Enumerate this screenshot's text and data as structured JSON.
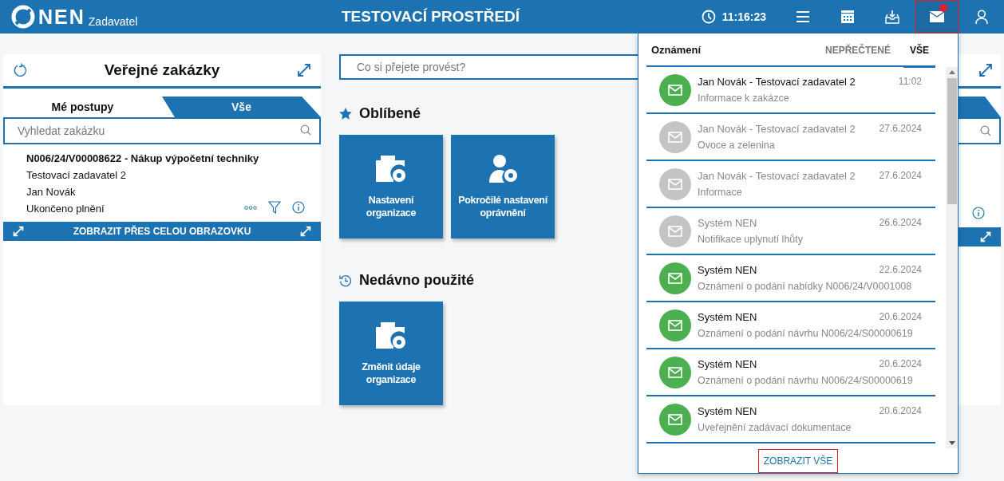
{
  "header": {
    "logo": "NEN",
    "role": "Zadavatel",
    "title": "TESTOVACÍ PROSTŘEDÍ",
    "time": "11:16:23",
    "nav": [
      {
        "kind": "menu",
        "selected": false,
        "badge": false
      },
      {
        "kind": "calendar",
        "selected": false,
        "badge": false
      },
      {
        "kind": "inbox",
        "selected": false,
        "badge": false
      },
      {
        "kind": "mail",
        "selected": true,
        "badge": true
      },
      {
        "kind": "user",
        "selected": false,
        "badge": false
      }
    ]
  },
  "contracts_panel": {
    "title": "Veřejné zakázky",
    "tabs": [
      {
        "label": "Mé postupy",
        "selected": true
      },
      {
        "label": "Vše",
        "selected": false
      }
    ],
    "search": {
      "placeholder": "Vyhledat zakázku"
    },
    "item": {
      "title": "N006/24/V00008622 - Nákup výpočetní techniky",
      "lines": [
        "Testovací zadavatel 2",
        "Jan Novák",
        "Ukončeno plnění"
      ]
    },
    "footer": "ZOBRAZIT PŘES CELOU OBRAZOVKU"
  },
  "command_search": {
    "placeholder": "Co si přejete provést?"
  },
  "favorites": {
    "title": "Oblíbené",
    "tiles": [
      {
        "label": "Nastavení organizace",
        "kind": "org"
      },
      {
        "label": "Pokročilé nastavení oprávnění",
        "kind": "user"
      }
    ]
  },
  "recent": {
    "title": "Nedávno použité",
    "tiles": [
      {
        "label": "Změnit údaje organizace",
        "kind": "org"
      }
    ]
  },
  "notifications": {
    "title": "Oznámení",
    "tabs": [
      {
        "label": "NEPŘEČTENÉ",
        "selected": false
      },
      {
        "label": "VŠE",
        "selected": true
      }
    ],
    "items": [
      {
        "sender": "Jan Novák - Testovací zadavatel 2",
        "date": "11:02",
        "subject": "Informace k zakázce",
        "unread": true
      },
      {
        "sender": "Jan Novák - Testovací zadavatel 2",
        "date": "27.6.2024",
        "subject": "Ovoce a zelenina",
        "unread": false
      },
      {
        "sender": "Jan Novák - Testovací zadavatel 2",
        "date": "27.6.2024",
        "subject": "Informace",
        "unread": false
      },
      {
        "sender": "Systém NEN",
        "date": "26.6.2024",
        "subject": "Notifikace uplynutí lhůty",
        "unread": false
      },
      {
        "sender": "Systém NEN",
        "date": "22.6.2024",
        "subject": "Oznámení o podání nabídky N006/24/V0001008",
        "unread": true
      },
      {
        "sender": "Systém NEN",
        "date": "20.6.2024",
        "subject": "Oznámení o podání návrhu N006/24/S00000619",
        "unread": true
      },
      {
        "sender": "Systém NEN",
        "date": "20.6.2024",
        "subject": "Oznámení o podání návrhu N006/24/S00000619",
        "unread": true
      },
      {
        "sender": "Systém NEN",
        "date": "20.6.2024",
        "subject": "Uveřejnění zadávací dokumentace",
        "unread": true
      }
    ],
    "show_all": "ZOBRAZIT VŠE"
  }
}
